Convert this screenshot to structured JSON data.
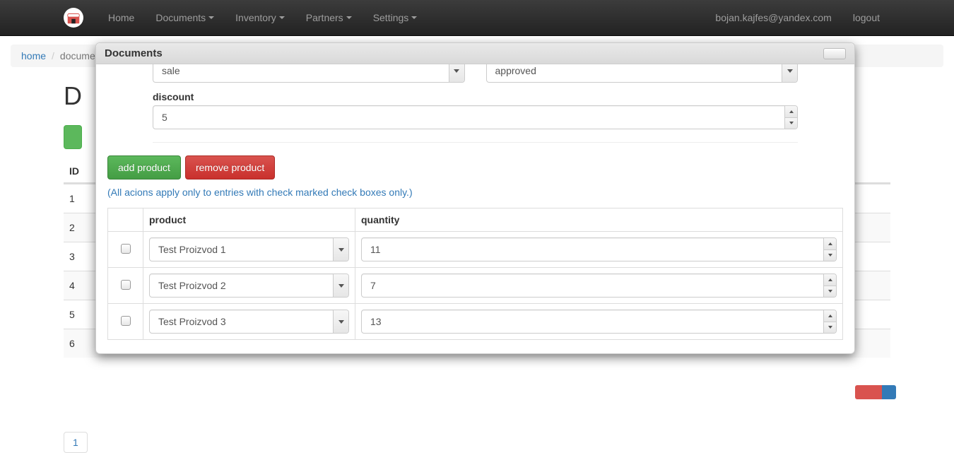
{
  "navbar": {
    "items": [
      {
        "label": "Home",
        "caret": false
      },
      {
        "label": "Documents",
        "caret": true
      },
      {
        "label": "Inventory",
        "caret": true
      },
      {
        "label": "Partners",
        "caret": true
      },
      {
        "label": "Settings",
        "caret": true
      }
    ],
    "user_email": "bojan.kajfes@yandex.com",
    "logout": "logout"
  },
  "breadcrumb": {
    "home": "home",
    "current": "docume"
  },
  "page": {
    "title_initial": "D",
    "id_header": "ID",
    "rows": [
      "1",
      "2",
      "3",
      "4",
      "5",
      "6"
    ],
    "pager": "1"
  },
  "modal": {
    "title": "Documents",
    "type_value": "sale",
    "status_value": "approved",
    "discount_label": "discount",
    "discount_value": "5",
    "add_product": "add product",
    "remove_product": "remove product",
    "hint": "(All acions apply only to entries with check marked check boxes only.)",
    "columns": {
      "product": "product",
      "quantity": "quantity"
    },
    "products": [
      {
        "name": "Test Proizvod 1",
        "qty": "11"
      },
      {
        "name": "Test Proizvod 2",
        "qty": "7"
      },
      {
        "name": "Test Proizvod 3",
        "qty": "13"
      }
    ]
  }
}
